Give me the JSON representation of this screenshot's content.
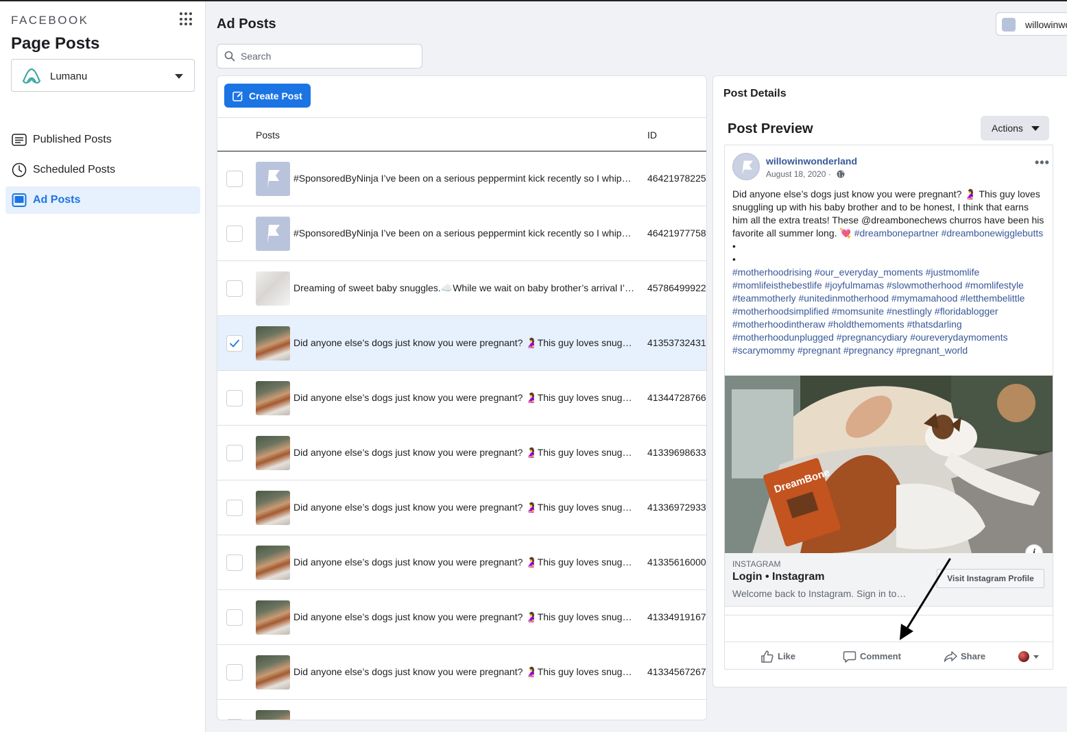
{
  "sidebar": {
    "brand": "FACEBOOK",
    "title": "Page Posts",
    "page_selector": {
      "value": "Lumanu"
    },
    "items": [
      {
        "label": "Published Posts",
        "icon": "published-posts-icon",
        "active": false
      },
      {
        "label": "Scheduled Posts",
        "icon": "clock-icon",
        "active": false
      },
      {
        "label": "Ad Posts",
        "icon": "ad-posts-icon",
        "active": true
      }
    ]
  },
  "header": {
    "title": "Ad Posts",
    "search_placeholder": "Search",
    "account": "willowinwonderland"
  },
  "posts_panel": {
    "create_label": "Create Post",
    "columns": {
      "posts": "Posts",
      "id": "ID"
    },
    "rows": [
      {
        "text": "#SponsoredByNinja I’ve been on a serious peppermint kick recently so I whipped up a batch of peppermint treats",
        "id": "46421978225",
        "thumb": "flag",
        "checked": false
      },
      {
        "text": "#SponsoredByNinja I’ve been on a serious peppermint kick recently so I whipped up a batch of peppermint treats",
        "id": "46421977758",
        "thumb": "flag",
        "checked": false
      },
      {
        "text": "Dreaming of sweet baby snuggles.☁️While we wait on baby brother’s arrival I’ve been getting everything ready",
        "id": "45786499922",
        "thumb": "baby",
        "checked": false
      },
      {
        "text": "Did anyone else’s dogs just know you were pregnant? 🤰This guy loves snuggling up with his baby brother",
        "id": "41353732431",
        "thumb": "dog",
        "checked": true
      },
      {
        "text": "Did anyone else’s dogs just know you were pregnant? 🤰This guy loves snuggling up with his baby brother",
        "id": "41344728766",
        "thumb": "dog",
        "checked": false
      },
      {
        "text": "Did anyone else’s dogs just know you were pregnant? 🤰This guy loves snuggling up with his baby brother",
        "id": "41339698633",
        "thumb": "dog",
        "checked": false
      },
      {
        "text": "Did anyone else’s dogs just know you were pregnant? 🤰This guy loves snuggling up with his baby brother",
        "id": "41336972933",
        "thumb": "dog",
        "checked": false
      },
      {
        "text": "Did anyone else’s dogs just know you were pregnant? 🤰This guy loves snuggling up with his baby brother",
        "id": "41335616000",
        "thumb": "dog",
        "checked": false
      },
      {
        "text": "Did anyone else’s dogs just know you were pregnant? 🤰This guy loves snuggling up with his baby brother",
        "id": "41334919167",
        "thumb": "dog",
        "checked": false
      },
      {
        "text": "Did anyone else’s dogs just know you were pregnant? 🤰This guy loves snuggling up with his baby brother",
        "id": "41334567267",
        "thumb": "dog",
        "checked": false
      },
      {
        "text": "",
        "id": "",
        "thumb": "dog",
        "checked": false
      }
    ]
  },
  "details": {
    "title": "Post Details",
    "preview_title": "Post Preview",
    "actions_label": "Actions",
    "post": {
      "author": "willowinwonderland",
      "date": "August 18, 2020 ·",
      "more": "•••",
      "caption_plain": "Did anyone else’s dogs just know you were pregnant? 🤰 This guy loves snuggling up with his baby brother and to be honest, I think that earns him all the extra treats! These @dreambonechews churros have been his favorite all summer long. 💘 ",
      "caption_tags_1": "#dreambonepartner #dreambonewigglebutts",
      "bullet_1": " •",
      "bullet_2": "•",
      "caption_tags_2": "#motherhoodrising #our_everyday_moments #justmomlife #momlifeisthebestlife #joyfulmamas #slowmotherhood #momlifestyle #teammotherly #unitedinmotherhood #mymamahood #letthembelittle #motherhoodsimplified #momsunite #nestlingly #floridablogger #motherhoodintheraw #holdthemoments #thatsdarling #motherhoodunplugged #pregnancydiary #oureverydaymoments #scarymommy #pregnant #pregnancy #pregnant_world",
      "photo_brand": "DreamBone",
      "info_icon": "i",
      "link_source": "INSTAGRAM",
      "link_title": "Login • Instagram",
      "link_desc": "Welcome back to Instagram. Sign in to…",
      "link_cta": "Visit Instagram Profile",
      "like_label": "Like",
      "comment_label": "Comment",
      "share_label": "Share"
    }
  },
  "colors": {
    "accent": "#1b74e4",
    "link": "#385898",
    "selected_row": "#e7f0fd"
  }
}
